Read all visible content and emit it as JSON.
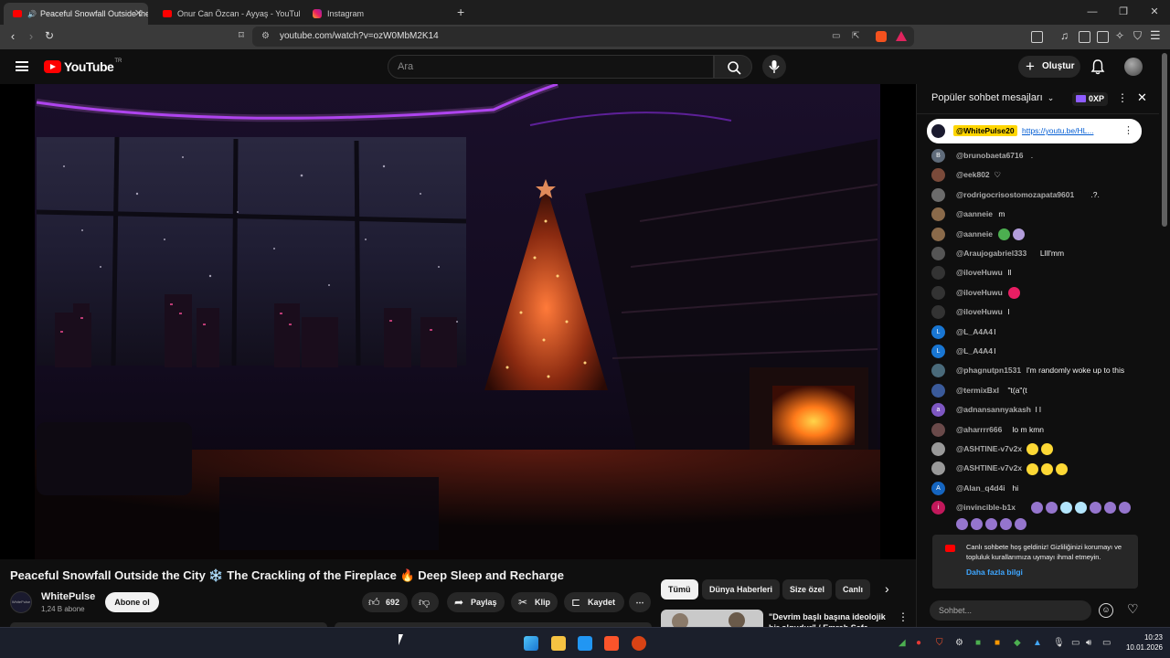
{
  "browser": {
    "tabs": [
      {
        "title": "Peaceful Snowfall Outside the",
        "active": true
      },
      {
        "title": "Onur Can Özcan - Ayyaş - YouTube",
        "active": false
      },
      {
        "title": "Instagram",
        "active": false
      }
    ],
    "new_tab": "+",
    "url": "youtube.com/watch?v=ozW0MbM2K14",
    "window_controls": [
      "—",
      "❐",
      "✕"
    ]
  },
  "youtube": {
    "logo": "YouTube",
    "region": "TR",
    "search_placeholder": "Ara",
    "create_label": "Oluştur"
  },
  "video": {
    "title": "Peaceful Snowfall Outside the City ❄️ The Crackling of the Fireplace 🔥 Deep Sleep and Recharge",
    "channel": "WhitePulse",
    "channel_avatar_text": "WhitePulse",
    "subscribers": "1,24 B abone",
    "subscribe_label": "Abone ol",
    "likes": "692",
    "share_label": "Paylaş",
    "clip_label": "Klip",
    "save_label": "Kaydet"
  },
  "chips": [
    "Tümü",
    "Dünya Haberleri",
    "Size özel",
    "Canlı"
  ],
  "recommendation": {
    "title": "\"Devrim başlı başına ideolojik bir olgudur\" / Emrah Safa"
  },
  "chat": {
    "title": "Popüler sohbet mesajları",
    "badge": "0XP",
    "pinned": {
      "author": "@WhitePulse20",
      "text": "https://youtu.be/HL..."
    },
    "messages": [
      {
        "author": "@brunobaeta6716",
        "text": ".",
        "initial": "B",
        "color": "#5f6b7a"
      },
      {
        "author": "@eek802",
        "text": "♡",
        "initial": "",
        "color": "#7a4a3a"
      },
      {
        "author": "@rodrigocrisostomozapata9601",
        "text": ".?.",
        "initial": "",
        "color": "#6b6b6b"
      },
      {
        "author": "@aanneie",
        "text": "m",
        "initial": "",
        "color": "#8a6a4a"
      },
      {
        "author": "@aanneie",
        "text": "",
        "initial": "",
        "color": "#8a6a4a",
        "emojis": [
          "#4caf50",
          "#b39ddb"
        ]
      },
      {
        "author": "@Araujogabriel333",
        "text": "Llll'mm",
        "initial": "",
        "color": "#555"
      },
      {
        "author": "@iloveHuwu",
        "text": "ll",
        "initial": "",
        "color": "#333"
      },
      {
        "author": "@iloveHuwu",
        "text": "",
        "initial": "",
        "color": "#333",
        "emojis": [
          "#e91e63"
        ]
      },
      {
        "author": "@iloveHuwu",
        "text": "l",
        "initial": "",
        "color": "#333"
      },
      {
        "author": "@L_A4A4",
        "text": "l",
        "initial": "L",
        "color": "#1976d2"
      },
      {
        "author": "@L_A4A4",
        "text": "l",
        "initial": "L",
        "color": "#1976d2"
      },
      {
        "author": "@phagnutpn1531",
        "text": "I'm randomly woke up to this",
        "initial": "",
        "color": "#4a6a7a"
      },
      {
        "author": "@termixBxl",
        "text": "\"t(a\"(t",
        "initial": "",
        "color": "#3a5a9a"
      },
      {
        "author": "@adnansannyakash",
        "text": "l l",
        "initial": "a",
        "color": "#7e57c2"
      },
      {
        "author": "@aharrrr666",
        "text": "lo m kmn",
        "initial": "",
        "color": "#6a4a4a"
      },
      {
        "author": "@ASHTINE-v7v2x",
        "text": "",
        "initial": "",
        "color": "#999",
        "emojis": [
          "#fdd835",
          "#fdd835"
        ]
      },
      {
        "author": "@ASHTINE-v7v2x",
        "text": "",
        "initial": "",
        "color": "#999",
        "emojis": [
          "#fdd835",
          "#fdd835",
          "#fdd835"
        ]
      },
      {
        "author": "@Alan_q4d4i",
        "text": "hi",
        "initial": "A",
        "color": "#1565c0"
      },
      {
        "author": "@invincible-b1x",
        "text": "",
        "initial": "i",
        "color": "#c2185b",
        "emojis": [
          "#9575cd",
          "#9575cd",
          "#b3e5fc",
          "#b3e5fc",
          "#9575cd",
          "#9575cd",
          "#9575cd"
        ]
      }
    ],
    "extra_emojis": [
      "#9575cd",
      "#9575cd",
      "#9575cd",
      "#9575cd",
      "#9575cd"
    ],
    "welcome": "Canlı sohbete hoş geldiniz! Gizliliğinizi korumayı ve topluluk kurallarımıza uymayı ihmal etmeyin.",
    "welcome_link": "Daha fazla bilgi",
    "input_placeholder": "Sohbet..."
  },
  "taskbar": {
    "time": "10:23",
    "date": "10.01.2026"
  },
  "colors": {
    "accent": "#ff0000",
    "link": "#3ea6ff",
    "background": "#0f0f0f"
  }
}
